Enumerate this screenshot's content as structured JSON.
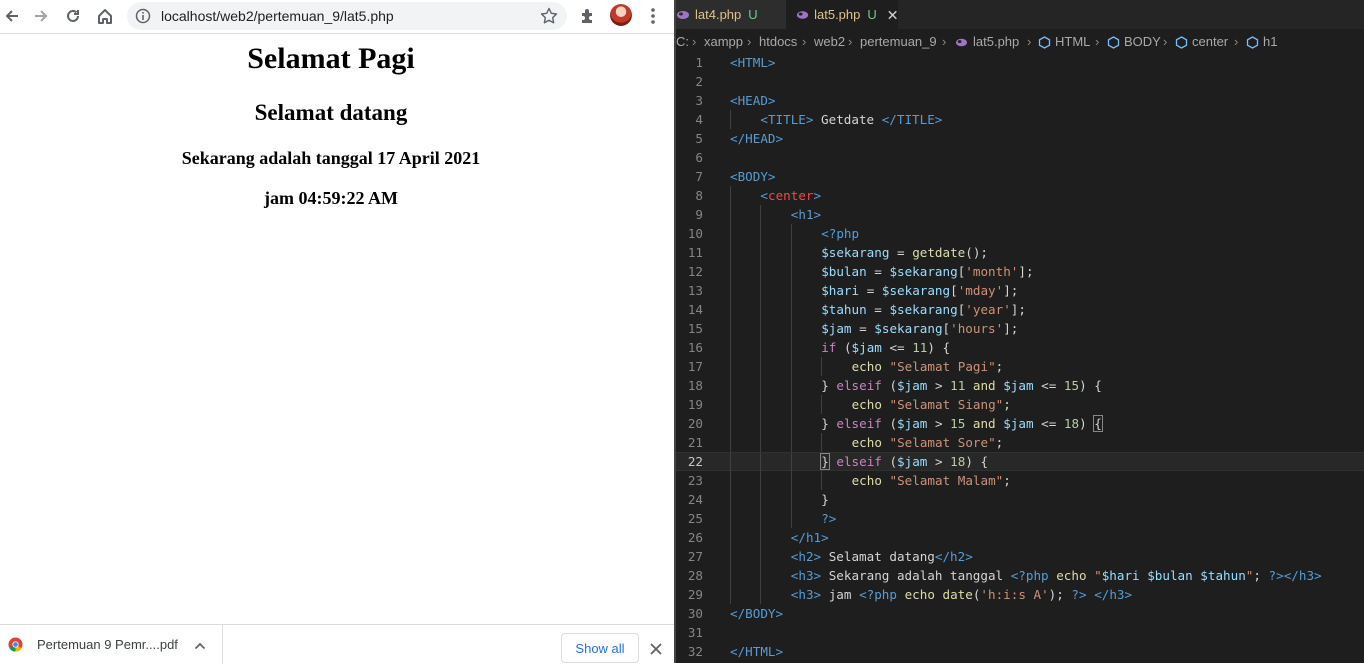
{
  "browser": {
    "url": "localhost/web2/pertemuan_9/lat5.php",
    "page": {
      "h1": "Selamat Pagi",
      "h2": "Selamat datang",
      "date_line": "Sekarang adalah tanggal 17 April 2021",
      "time_line": "jam 04:59:22 AM"
    },
    "download": {
      "file_name": "Pertemuan 9 Pemr....pdf",
      "show_all_label": "Show all"
    },
    "icons": [
      "back-icon",
      "forward-icon",
      "reload-icon",
      "home-icon",
      "info-icon",
      "star-icon",
      "extensions-icon",
      "avatar",
      "menu-icon",
      "chrome-icon",
      "chevron-up-icon",
      "close-icon"
    ]
  },
  "editor": {
    "tabs": [
      {
        "label": "lat4.php",
        "status": "U"
      },
      {
        "label": "lat5.php",
        "status": "U",
        "active": true
      }
    ],
    "breadcrumbs": [
      "C:",
      "xampp",
      "htdocs",
      "web2",
      "pertemuan_9",
      "lat5.php",
      "HTML",
      "BODY",
      "center",
      "h1"
    ],
    "active_line": 22,
    "code": [
      {
        "n": "1",
        "indent": 0,
        "tokens": [
          {
            "t": "<HTML>",
            "c": "tag"
          }
        ]
      },
      {
        "n": "2",
        "indent": 0,
        "tokens": []
      },
      {
        "n": "3",
        "indent": 0,
        "tokens": [
          {
            "t": "<HEAD>",
            "c": "tag"
          }
        ]
      },
      {
        "n": "4",
        "indent": 1,
        "tokens": [
          {
            "t": "<TITLE>",
            "c": "tag"
          },
          {
            "t": " Getdate ",
            "c": "txt"
          },
          {
            "t": "</TITLE>",
            "c": "tag"
          }
        ]
      },
      {
        "n": "5",
        "indent": 0,
        "tokens": [
          {
            "t": "</HEAD>",
            "c": "tag"
          }
        ]
      },
      {
        "n": "6",
        "indent": 0,
        "tokens": []
      },
      {
        "n": "7",
        "indent": 0,
        "tokens": [
          {
            "t": "<BODY>",
            "c": "tag"
          }
        ]
      },
      {
        "n": "8",
        "indent": 1,
        "tokens": [
          {
            "t": "<",
            "c": "tag"
          },
          {
            "t": "center",
            "c": "red"
          },
          {
            "t": ">",
            "c": "tag"
          }
        ]
      },
      {
        "n": "9",
        "indent": 2,
        "tokens": [
          {
            "t": "<h1>",
            "c": "tag"
          }
        ]
      },
      {
        "n": "10",
        "indent": 3,
        "tokens": [
          {
            "t": "<?php",
            "c": "php"
          }
        ]
      },
      {
        "n": "11",
        "indent": 3,
        "tokens": [
          {
            "t": "$sekarang",
            "c": "var"
          },
          {
            "t": " = ",
            "c": "txt"
          },
          {
            "t": "getdate",
            "c": "fn"
          },
          {
            "t": "();",
            "c": "txt"
          }
        ]
      },
      {
        "n": "12",
        "indent": 3,
        "tokens": [
          {
            "t": "$bulan",
            "c": "var"
          },
          {
            "t": " = ",
            "c": "txt"
          },
          {
            "t": "$sekarang",
            "c": "var"
          },
          {
            "t": "[",
            "c": "txt"
          },
          {
            "t": "'month'",
            "c": "str"
          },
          {
            "t": "];",
            "c": "txt"
          }
        ]
      },
      {
        "n": "13",
        "indent": 3,
        "tokens": [
          {
            "t": "$hari",
            "c": "var"
          },
          {
            "t": " = ",
            "c": "txt"
          },
          {
            "t": "$sekarang",
            "c": "var"
          },
          {
            "t": "[",
            "c": "txt"
          },
          {
            "t": "'mday'",
            "c": "str"
          },
          {
            "t": "];",
            "c": "txt"
          }
        ]
      },
      {
        "n": "14",
        "indent": 3,
        "tokens": [
          {
            "t": "$tahun",
            "c": "var"
          },
          {
            "t": " = ",
            "c": "txt"
          },
          {
            "t": "$sekarang",
            "c": "var"
          },
          {
            "t": "[",
            "c": "txt"
          },
          {
            "t": "'year'",
            "c": "str"
          },
          {
            "t": "];",
            "c": "txt"
          }
        ]
      },
      {
        "n": "15",
        "indent": 3,
        "tokens": [
          {
            "t": "$jam",
            "c": "var"
          },
          {
            "t": " = ",
            "c": "txt"
          },
          {
            "t": "$sekarang",
            "c": "var"
          },
          {
            "t": "[",
            "c": "txt"
          },
          {
            "t": "'hours'",
            "c": "str"
          },
          {
            "t": "];",
            "c": "txt"
          }
        ]
      },
      {
        "n": "16",
        "indent": 3,
        "tokens": [
          {
            "t": "if",
            "c": "kw"
          },
          {
            "t": " (",
            "c": "txt"
          },
          {
            "t": "$jam",
            "c": "var"
          },
          {
            "t": " <= ",
            "c": "txt"
          },
          {
            "t": "11",
            "c": "num"
          },
          {
            "t": ") {",
            "c": "txt"
          }
        ]
      },
      {
        "n": "17",
        "indent": 4,
        "tokens": [
          {
            "t": "echo ",
            "c": "fn"
          },
          {
            "t": "\"Selamat Pagi\"",
            "c": "str"
          },
          {
            "t": ";",
            "c": "txt"
          }
        ]
      },
      {
        "n": "18",
        "indent": 3,
        "tokens": [
          {
            "t": "} ",
            "c": "txt"
          },
          {
            "t": "elseif",
            "c": "kw"
          },
          {
            "t": " (",
            "c": "txt"
          },
          {
            "t": "$jam",
            "c": "var"
          },
          {
            "t": " > ",
            "c": "txt"
          },
          {
            "t": "11",
            "c": "num"
          },
          {
            "t": " and ",
            "c": "fn"
          },
          {
            "t": "$jam",
            "c": "var"
          },
          {
            "t": " <= ",
            "c": "txt"
          },
          {
            "t": "15",
            "c": "num"
          },
          {
            "t": ") {",
            "c": "txt"
          }
        ]
      },
      {
        "n": "19",
        "indent": 4,
        "tokens": [
          {
            "t": "echo ",
            "c": "fn"
          },
          {
            "t": "\"Selamat Siang\"",
            "c": "str"
          },
          {
            "t": ";",
            "c": "txt"
          }
        ]
      },
      {
        "n": "20",
        "indent": 3,
        "tokens": [
          {
            "t": "} ",
            "c": "txt"
          },
          {
            "t": "elseif",
            "c": "kw"
          },
          {
            "t": " (",
            "c": "txt"
          },
          {
            "t": "$jam",
            "c": "var"
          },
          {
            "t": " > ",
            "c": "txt"
          },
          {
            "t": "15",
            "c": "num"
          },
          {
            "t": " and ",
            "c": "fn"
          },
          {
            "t": "$jam",
            "c": "var"
          },
          {
            "t": " <= ",
            "c": "txt"
          },
          {
            "t": "18",
            "c": "num"
          },
          {
            "t": ") ",
            "c": "txt"
          },
          {
            "t": "{",
            "c": "br"
          }
        ]
      },
      {
        "n": "21",
        "indent": 4,
        "tokens": [
          {
            "t": "echo ",
            "c": "fn"
          },
          {
            "t": "\"Selamat Sore\"",
            "c": "str"
          },
          {
            "t": ";",
            "c": "txt"
          }
        ]
      },
      {
        "n": "22",
        "indent": 3,
        "tokens": [
          {
            "t": "}",
            "c": "br"
          },
          {
            "t": " ",
            "c": "txt"
          },
          {
            "t": "elseif",
            "c": "kw"
          },
          {
            "t": " (",
            "c": "txt"
          },
          {
            "t": "$jam",
            "c": "var"
          },
          {
            "t": " > ",
            "c": "txt"
          },
          {
            "t": "18",
            "c": "num"
          },
          {
            "t": ") {",
            "c": "txt"
          }
        ]
      },
      {
        "n": "23",
        "indent": 4,
        "tokens": [
          {
            "t": "echo ",
            "c": "fn"
          },
          {
            "t": "\"Selamat Malam\"",
            "c": "str"
          },
          {
            "t": ";",
            "c": "txt"
          }
        ]
      },
      {
        "n": "24",
        "indent": 3,
        "tokens": [
          {
            "t": "}",
            "c": "txt"
          }
        ]
      },
      {
        "n": "25",
        "indent": 3,
        "tokens": [
          {
            "t": "?>",
            "c": "php"
          }
        ]
      },
      {
        "n": "26",
        "indent": 2,
        "tokens": [
          {
            "t": "</h1>",
            "c": "tag"
          }
        ]
      },
      {
        "n": "27",
        "indent": 2,
        "tokens": [
          {
            "t": "<h2>",
            "c": "tag"
          },
          {
            "t": " Selamat datang",
            "c": "txt"
          },
          {
            "t": "</h2>",
            "c": "tag"
          }
        ]
      },
      {
        "n": "28",
        "indent": 2,
        "tokens": [
          {
            "t": "<h3>",
            "c": "tag"
          },
          {
            "t": " Sekarang adalah tanggal ",
            "c": "txt"
          },
          {
            "t": "<?php",
            "c": "php"
          },
          {
            "t": " echo ",
            "c": "fn"
          },
          {
            "t": "\"",
            "c": "str"
          },
          {
            "t": "$hari $bulan $tahun",
            "c": "var"
          },
          {
            "t": "\"",
            "c": "str"
          },
          {
            "t": "; ",
            "c": "txt"
          },
          {
            "t": "?>",
            "c": "php"
          },
          {
            "t": "</h3>",
            "c": "tag"
          }
        ]
      },
      {
        "n": "29",
        "indent": 2,
        "tokens": [
          {
            "t": "<h3>",
            "c": "tag"
          },
          {
            "t": " jam ",
            "c": "txt"
          },
          {
            "t": "<?php",
            "c": "php"
          },
          {
            "t": " echo ",
            "c": "fn"
          },
          {
            "t": "date",
            "c": "fn"
          },
          {
            "t": "(",
            "c": "txt"
          },
          {
            "t": "'h:i:s A'",
            "c": "str"
          },
          {
            "t": "); ",
            "c": "txt"
          },
          {
            "t": "?>",
            "c": "php"
          },
          {
            "t": " ",
            "c": "txt"
          },
          {
            "t": "</h3>",
            "c": "tag"
          }
        ]
      },
      {
        "n": "30",
        "indent": 0,
        "tokens": [
          {
            "t": "</BODY>",
            "c": "tag"
          }
        ]
      },
      {
        "n": "31",
        "indent": 0,
        "tokens": []
      },
      {
        "n": "32",
        "indent": 0,
        "tokens": [
          {
            "t": "</HTML>",
            "c": "tag"
          }
        ]
      }
    ],
    "colors": {
      "background": "#1e1e1e",
      "tag": "#569cd6",
      "variable": "#9cdcfe",
      "string": "#ce9178",
      "number": "#b5cea8",
      "keyword": "#c586c0",
      "function": "#dcdcaa",
      "untracked": "#73c991"
    }
  }
}
